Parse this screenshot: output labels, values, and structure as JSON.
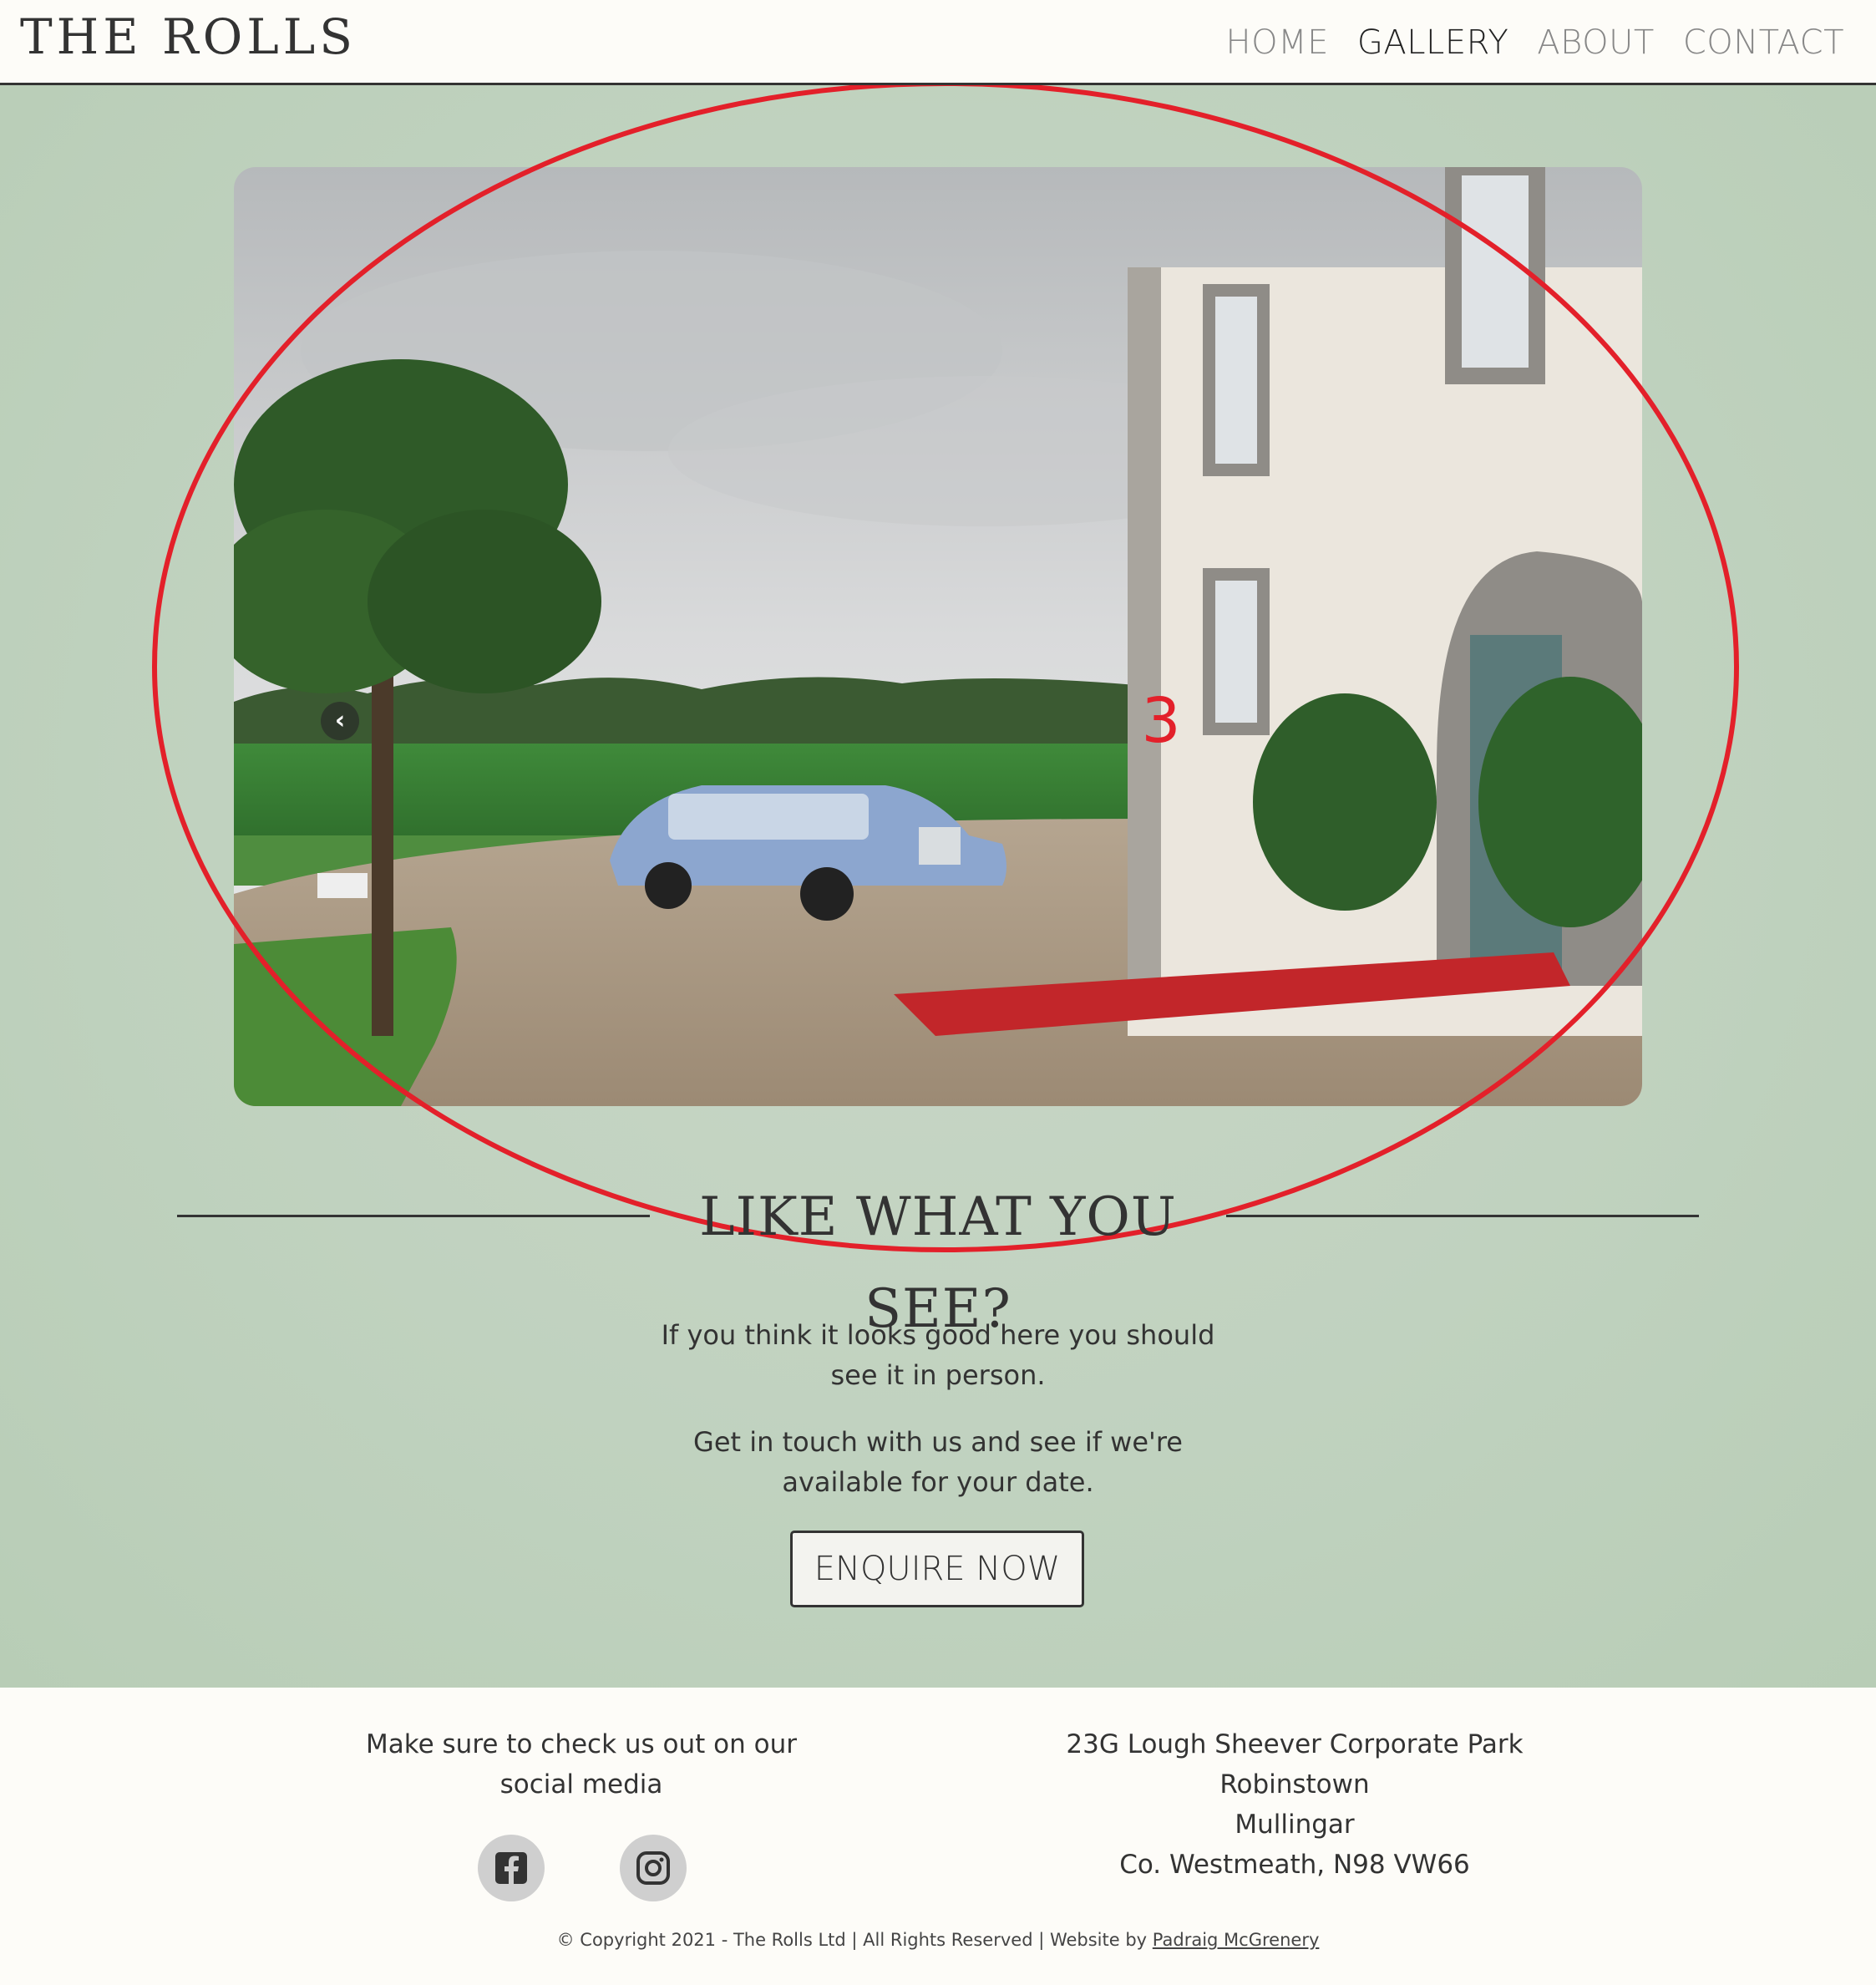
{
  "nav": {
    "brand": "THE ROLLS",
    "links": [
      "HOME",
      "GALLERY",
      "ABOUT",
      "CONTACT"
    ],
    "active": "GALLERY"
  },
  "carousel": {
    "slide_number": "3",
    "prev_icon": "chevron-left-icon",
    "next_icon": "chevron-right-icon",
    "annotation_color": "#e3202a"
  },
  "cta": {
    "heading": "LIKE WHAT YOU SEE?",
    "para1": "If you think it looks good here you should see it in person.",
    "para2": "Get in touch with us and see if we're available for your date.",
    "button": "ENQUIRE NOW"
  },
  "footer": {
    "social_text": "Make sure to check us out on our social media",
    "social_icons": [
      "facebook-icon",
      "instagram-icon"
    ],
    "address": [
      "23G Lough Sheever Corporate Park",
      "Robinstown",
      "Mullingar",
      "Co. Westmeath, N98 VW66"
    ],
    "copyright_prefix": "©",
    "copyright_text": "Copyright 2021 - The Rolls Ltd | All Rights Reserved | Website by",
    "author": "Padraig McGrenery"
  },
  "colors": {
    "main_bg": "#c0d2bf",
    "page_bg": "#fdfcf8",
    "text": "#333333",
    "annotation": "#e3202a"
  }
}
